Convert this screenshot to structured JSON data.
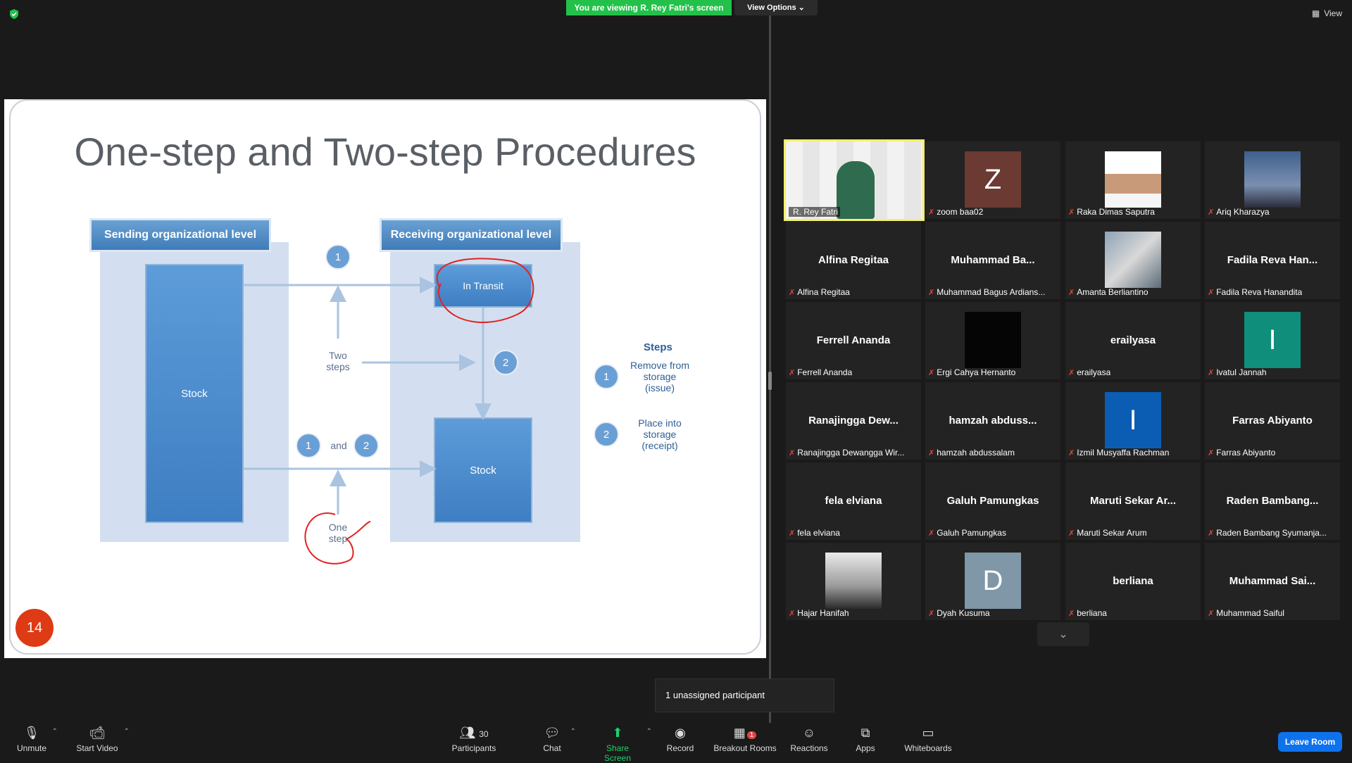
{
  "banner": {
    "viewing": "You are viewing R. Rey Fatri's screen",
    "view_options": "View Options",
    "view": "View"
  },
  "slide": {
    "title": "One-step and Two-step Procedures",
    "sending": "Sending organizational level",
    "receiving": "Receiving organizational level",
    "stock_left": "Stock",
    "in_transit": "In Transit",
    "stock_right": "Stock",
    "two_steps": "Two\nsteps",
    "one_step": "One\nstep",
    "and": "and",
    "steps_title": "Steps",
    "step1": "Remove from\nstorage\n(issue)",
    "step2": "Place into\nstorage\n(receipt)",
    "badge1": "1",
    "badge2": "2",
    "page_number": "14"
  },
  "tiles": [
    {
      "label": "R. Rey Fatri",
      "name": "",
      "thumb": "video",
      "active": true
    },
    {
      "label": "zoom baa02",
      "name": "",
      "thumb": "Z",
      "color": "#6b3a33"
    },
    {
      "label": "Raka Dimas Saputra",
      "name": "",
      "thumb": "photo"
    },
    {
      "label": "Ariq Kharazya",
      "name": "",
      "thumb": "sunset"
    },
    {
      "label": "Alfina Regitaa",
      "name": "Alfina Regitaa"
    },
    {
      "label": "Muhammad Bagus Ardians...",
      "name": "Muhammad  Ba..."
    },
    {
      "label": "Amanta Berliantino",
      "name": "",
      "thumb": "cat"
    },
    {
      "label": "Fadila Reva Hanandita",
      "name": "Fadila Reva Han..."
    },
    {
      "label": "Ferrell Ananda",
      "name": "Ferrell Ananda"
    },
    {
      "label": "Ergi Cahya Hernanto",
      "name": "",
      "thumb": "black"
    },
    {
      "label": "erailyasa",
      "name": "erailyasa"
    },
    {
      "label": "Ivatul Jannah",
      "name": "",
      "thumb": "I",
      "color": "#0f8f7b"
    },
    {
      "label": "Ranajingga Dewangga Wir...",
      "name": "Ranajingga  Dew..."
    },
    {
      "label": "hamzah abdussalam",
      "name": "hamzah  abduss..."
    },
    {
      "label": "Izmil Musyaffa Rachman",
      "name": "",
      "thumb": "I",
      "color": "#0b5db3"
    },
    {
      "label": "Farras Abiyanto",
      "name": "Farras Abiyanto"
    },
    {
      "label": "fela elviana",
      "name": "fela elviana"
    },
    {
      "label": "Galuh Pamungkas",
      "name": "Galuh Pamungkas"
    },
    {
      "label": "Maruti Sekar Arum",
      "name": "Maruti  Sekar  Ar..."
    },
    {
      "label": "Raden Bambang Syumanja...",
      "name": "Raden  Bambang..."
    },
    {
      "label": "Hajar Hanifah",
      "name": "",
      "thumb": "bw"
    },
    {
      "label": "Dyah Kusuma",
      "name": "",
      "thumb": "D",
      "color": "#7f97a6"
    },
    {
      "label": "berliana",
      "name": "berliana"
    },
    {
      "label": "Muhammad Saiful",
      "name": "Muhammad  Sai..."
    }
  ],
  "unassigned": "1 unassigned participant",
  "toolbar": {
    "unmute": "Unmute",
    "start_video": "Start Video",
    "participants": "Participants",
    "participants_count": "30",
    "chat": "Chat",
    "share_screen": "Share Screen",
    "record": "Record",
    "breakout": "Breakout Rooms",
    "breakout_badge": "1",
    "reactions": "Reactions",
    "apps": "Apps",
    "whiteboards": "Whiteboards",
    "leave": "Leave Room"
  },
  "colors": {
    "banner_green": "#23c14a",
    "leave_blue": "#0e72ed",
    "active_border": "#f3f06b",
    "muted_red": "#e0453c"
  }
}
